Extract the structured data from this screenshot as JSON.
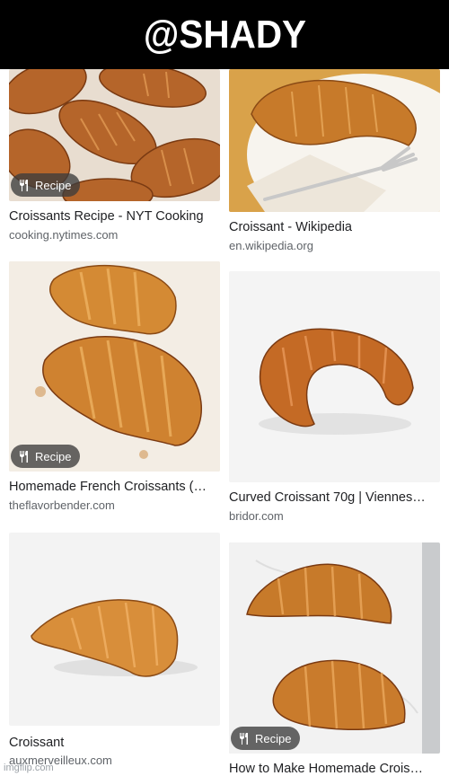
{
  "banner": {
    "text": "@SHADY"
  },
  "results": [
    {
      "title": "Croissants Recipe - NYT Cooking",
      "source": "cooking.nytimes.com",
      "badge": "Recipe"
    },
    {
      "title": "Croissant - Wikipedia",
      "source": "en.wikipedia.org",
      "badge": ""
    },
    {
      "title": "Homemade French Croissants (…",
      "source": "theflavorbender.com",
      "badge": "Recipe"
    },
    {
      "title": "Curved Croissant 70g | Viennes…",
      "source": "bridor.com",
      "badge": ""
    },
    {
      "title": "Croissant",
      "source": "auxmerveilleux.com",
      "badge": ""
    },
    {
      "title": "How to Make Homemade Crois…",
      "source": "",
      "badge": "Recipe"
    }
  ],
  "watermark": "imgflip.com",
  "colors": {
    "banner_bg": "#000000",
    "title": "#202124",
    "source": "#5f6368"
  }
}
